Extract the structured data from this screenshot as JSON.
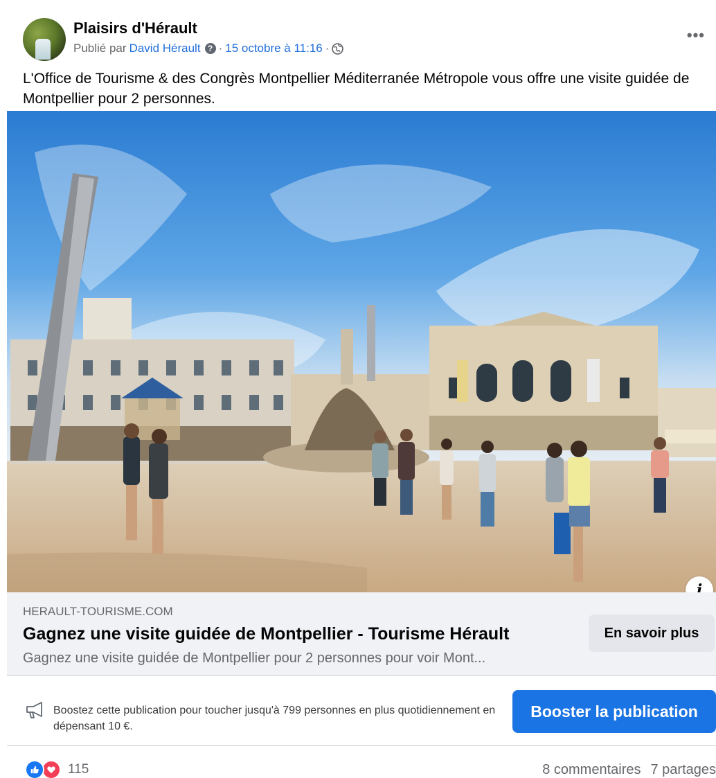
{
  "post": {
    "page_name": "Plaisirs d'Hérault",
    "published_by_prefix": "Publié par",
    "author": "David Hérault",
    "separator": "·",
    "date": "15 octobre à 11:16",
    "text": "L'Office de Tourisme & des Congrès Montpellier Méditerranée Métropole vous offre une visite guidée de Montpellier pour 2 personnes."
  },
  "link_preview": {
    "domain": "HERAULT-TOURISME.COM",
    "title": "Gagnez une visite guidée de Montpellier - Tourisme Hérault",
    "description": "Gagnez une visite guidée de Montpellier pour 2 personnes pour voir Mont...",
    "cta_label": "En savoir plus"
  },
  "boost": {
    "text": "Boostez cette publication pour toucher jusqu'à 799 personnes en plus quotidiennement en dépensant 10 €.",
    "button_label": "Booster la publication"
  },
  "engagement": {
    "reaction_count": "115",
    "comments": "8 commentaires",
    "shares": "7 partages"
  },
  "icons": {
    "more": "more-options-icon",
    "audience": "globe-icon",
    "help": "question-icon",
    "boost": "megaphone-icon",
    "info": "info-icon",
    "like": "like-icon",
    "love": "love-icon"
  },
  "colors": {
    "link": "#216fdb",
    "primary_button": "#1b74e4",
    "like": "#1877f2",
    "love": "#f33e58"
  }
}
